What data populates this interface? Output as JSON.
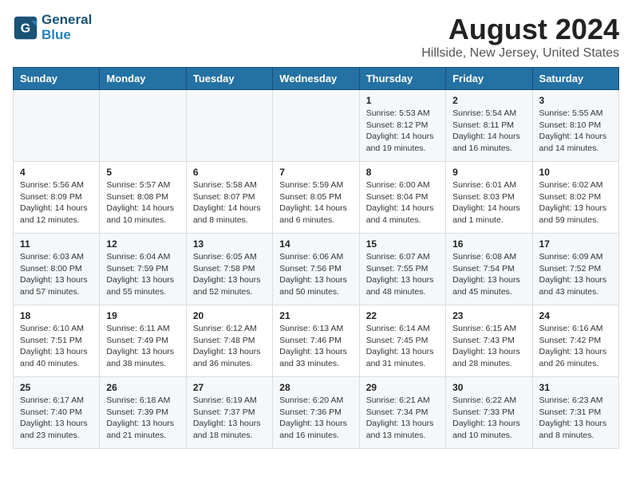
{
  "header": {
    "logo_line1": "General",
    "logo_line2": "Blue",
    "title": "August 2024",
    "subtitle": "Hillside, New Jersey, United States"
  },
  "weekdays": [
    "Sunday",
    "Monday",
    "Tuesday",
    "Wednesday",
    "Thursday",
    "Friday",
    "Saturday"
  ],
  "weeks": [
    [
      {
        "day": "",
        "info": ""
      },
      {
        "day": "",
        "info": ""
      },
      {
        "day": "",
        "info": ""
      },
      {
        "day": "",
        "info": ""
      },
      {
        "day": "1",
        "info": "Sunrise: 5:53 AM\nSunset: 8:12 PM\nDaylight: 14 hours\nand 19 minutes."
      },
      {
        "day": "2",
        "info": "Sunrise: 5:54 AM\nSunset: 8:11 PM\nDaylight: 14 hours\nand 16 minutes."
      },
      {
        "day": "3",
        "info": "Sunrise: 5:55 AM\nSunset: 8:10 PM\nDaylight: 14 hours\nand 14 minutes."
      }
    ],
    [
      {
        "day": "4",
        "info": "Sunrise: 5:56 AM\nSunset: 8:09 PM\nDaylight: 14 hours\nand 12 minutes."
      },
      {
        "day": "5",
        "info": "Sunrise: 5:57 AM\nSunset: 8:08 PM\nDaylight: 14 hours\nand 10 minutes."
      },
      {
        "day": "6",
        "info": "Sunrise: 5:58 AM\nSunset: 8:07 PM\nDaylight: 14 hours\nand 8 minutes."
      },
      {
        "day": "7",
        "info": "Sunrise: 5:59 AM\nSunset: 8:05 PM\nDaylight: 14 hours\nand 6 minutes."
      },
      {
        "day": "8",
        "info": "Sunrise: 6:00 AM\nSunset: 8:04 PM\nDaylight: 14 hours\nand 4 minutes."
      },
      {
        "day": "9",
        "info": "Sunrise: 6:01 AM\nSunset: 8:03 PM\nDaylight: 14 hours\nand 1 minute."
      },
      {
        "day": "10",
        "info": "Sunrise: 6:02 AM\nSunset: 8:02 PM\nDaylight: 13 hours\nand 59 minutes."
      }
    ],
    [
      {
        "day": "11",
        "info": "Sunrise: 6:03 AM\nSunset: 8:00 PM\nDaylight: 13 hours\nand 57 minutes."
      },
      {
        "day": "12",
        "info": "Sunrise: 6:04 AM\nSunset: 7:59 PM\nDaylight: 13 hours\nand 55 minutes."
      },
      {
        "day": "13",
        "info": "Sunrise: 6:05 AM\nSunset: 7:58 PM\nDaylight: 13 hours\nand 52 minutes."
      },
      {
        "day": "14",
        "info": "Sunrise: 6:06 AM\nSunset: 7:56 PM\nDaylight: 13 hours\nand 50 minutes."
      },
      {
        "day": "15",
        "info": "Sunrise: 6:07 AM\nSunset: 7:55 PM\nDaylight: 13 hours\nand 48 minutes."
      },
      {
        "day": "16",
        "info": "Sunrise: 6:08 AM\nSunset: 7:54 PM\nDaylight: 13 hours\nand 45 minutes."
      },
      {
        "day": "17",
        "info": "Sunrise: 6:09 AM\nSunset: 7:52 PM\nDaylight: 13 hours\nand 43 minutes."
      }
    ],
    [
      {
        "day": "18",
        "info": "Sunrise: 6:10 AM\nSunset: 7:51 PM\nDaylight: 13 hours\nand 40 minutes."
      },
      {
        "day": "19",
        "info": "Sunrise: 6:11 AM\nSunset: 7:49 PM\nDaylight: 13 hours\nand 38 minutes."
      },
      {
        "day": "20",
        "info": "Sunrise: 6:12 AM\nSunset: 7:48 PM\nDaylight: 13 hours\nand 36 minutes."
      },
      {
        "day": "21",
        "info": "Sunrise: 6:13 AM\nSunset: 7:46 PM\nDaylight: 13 hours\nand 33 minutes."
      },
      {
        "day": "22",
        "info": "Sunrise: 6:14 AM\nSunset: 7:45 PM\nDaylight: 13 hours\nand 31 minutes."
      },
      {
        "day": "23",
        "info": "Sunrise: 6:15 AM\nSunset: 7:43 PM\nDaylight: 13 hours\nand 28 minutes."
      },
      {
        "day": "24",
        "info": "Sunrise: 6:16 AM\nSunset: 7:42 PM\nDaylight: 13 hours\nand 26 minutes."
      }
    ],
    [
      {
        "day": "25",
        "info": "Sunrise: 6:17 AM\nSunset: 7:40 PM\nDaylight: 13 hours\nand 23 minutes."
      },
      {
        "day": "26",
        "info": "Sunrise: 6:18 AM\nSunset: 7:39 PM\nDaylight: 13 hours\nand 21 minutes."
      },
      {
        "day": "27",
        "info": "Sunrise: 6:19 AM\nSunset: 7:37 PM\nDaylight: 13 hours\nand 18 minutes."
      },
      {
        "day": "28",
        "info": "Sunrise: 6:20 AM\nSunset: 7:36 PM\nDaylight: 13 hours\nand 16 minutes."
      },
      {
        "day": "29",
        "info": "Sunrise: 6:21 AM\nSunset: 7:34 PM\nDaylight: 13 hours\nand 13 minutes."
      },
      {
        "day": "30",
        "info": "Sunrise: 6:22 AM\nSunset: 7:33 PM\nDaylight: 13 hours\nand 10 minutes."
      },
      {
        "day": "31",
        "info": "Sunrise: 6:23 AM\nSunset: 7:31 PM\nDaylight: 13 hours\nand 8 minutes."
      }
    ]
  ]
}
